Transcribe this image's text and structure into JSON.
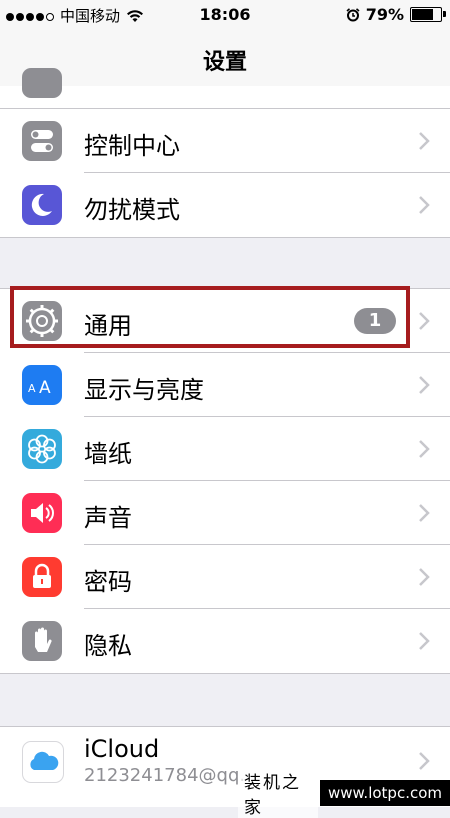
{
  "status_bar": {
    "carrier": "中国移动",
    "time": "18:06",
    "battery_percent": "79%",
    "battery_level": 0.79
  },
  "nav": {
    "title": "设置"
  },
  "group1": [
    {
      "label": "控制中心",
      "icon": "control-center-icon",
      "color": "#8e8e93"
    },
    {
      "label": "勿扰模式",
      "icon": "moon-icon",
      "color": "#5856d6"
    }
  ],
  "group2": [
    {
      "label": "通用",
      "icon": "gear-icon",
      "color": "#8e8e93",
      "badge": "1"
    },
    {
      "label": "显示与亮度",
      "icon": "display-brightness-icon",
      "color": "#1e7cf2"
    },
    {
      "label": "墙纸",
      "icon": "wallpaper-icon",
      "color": "#34aadc"
    },
    {
      "label": "声音",
      "icon": "speaker-icon",
      "color": "#ff2d55"
    },
    {
      "label": "密码",
      "icon": "lock-icon",
      "color": "#ff3b30"
    },
    {
      "label": "隐私",
      "icon": "hand-icon",
      "color": "#8e8e93"
    }
  ],
  "group3": {
    "label": "iCloud",
    "sublabel": "2123241784@qq.",
    "icon": "icloud-icon"
  },
  "watermark": {
    "text": "装机之家",
    "url": "www.lotpc.com"
  },
  "colors": {
    "highlight": "#a61c1e",
    "badge": "#8e8e93"
  }
}
